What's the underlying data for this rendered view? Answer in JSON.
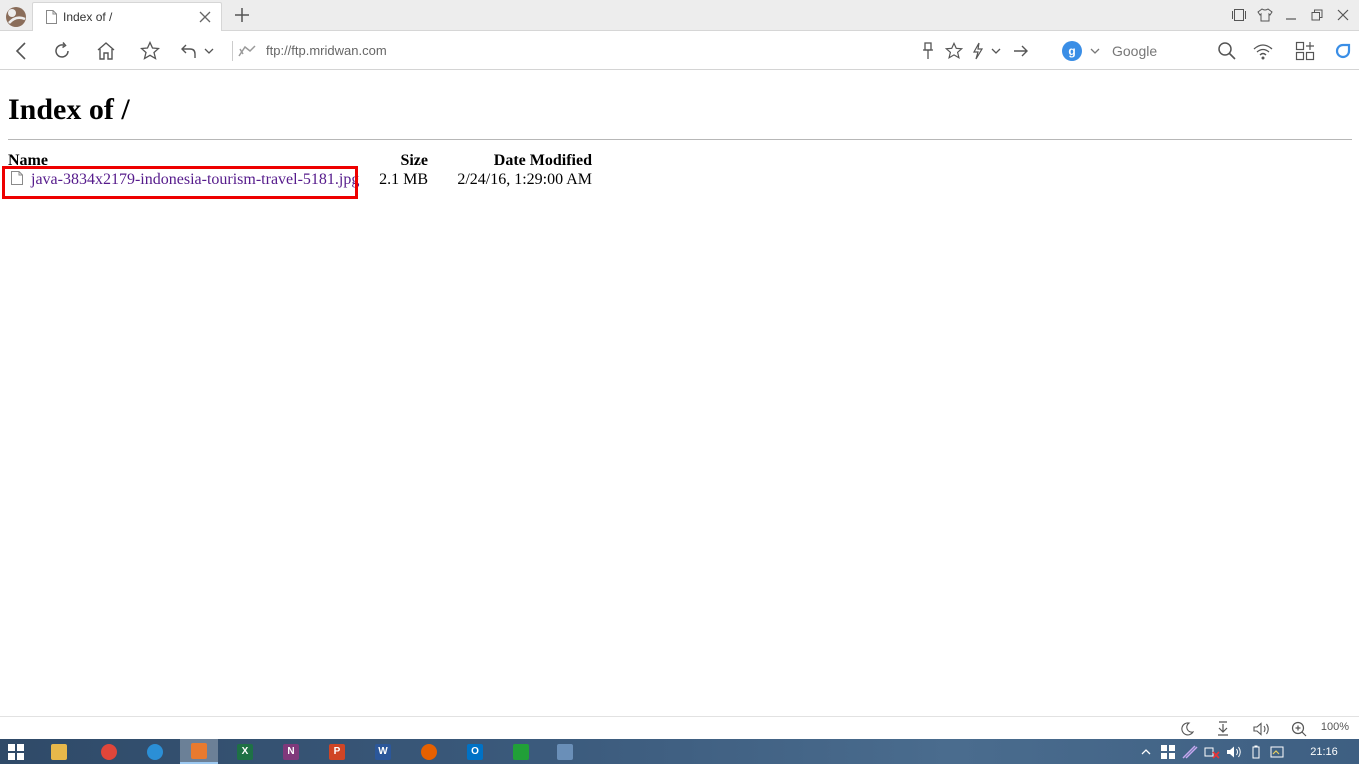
{
  "browser": {
    "tab": {
      "title": "Index of /"
    },
    "address_bar": {
      "url": "ftp://ftp.mridwan.com"
    },
    "search": {
      "engine_badge": "g",
      "label": "Google"
    }
  },
  "page": {
    "heading": "Index of /",
    "columns": {
      "name": "Name",
      "size": "Size",
      "date": "Date Modified"
    },
    "files": [
      {
        "name": "java-3834x2179-indonesia-tourism-travel-5181.jpg",
        "size": "2.1 MB",
        "date": "2/24/16, 1:29:00 AM"
      }
    ]
  },
  "status": {
    "zoom": "100%"
  },
  "taskbar": {
    "apps": [
      {
        "icon": "file-explorer-icon",
        "color": "#e8b84a"
      },
      {
        "icon": "chrome-icon",
        "color": "#e0463a"
      },
      {
        "icon": "internet-explorer-icon",
        "color": "#2b8fd6"
      },
      {
        "icon": "uc-browser-icon",
        "color": "#e87a2e"
      },
      {
        "icon": "excel-icon",
        "color": "#1e7145",
        "glyph": "X"
      },
      {
        "icon": "onenote-icon",
        "color": "#80397b",
        "glyph": "N"
      },
      {
        "icon": "powerpoint-icon",
        "color": "#d04525",
        "glyph": "P"
      },
      {
        "icon": "word-icon",
        "color": "#2b579a",
        "glyph": "W"
      },
      {
        "icon": "firefox-icon",
        "color": "#e66000"
      },
      {
        "icon": "outlook-icon",
        "color": "#0072c6",
        "glyph": "O"
      },
      {
        "icon": "spreadsheet-app-icon",
        "color": "#21a038"
      },
      {
        "icon": "virtualbox-icon",
        "color": "#6a8fb8"
      }
    ],
    "clock": "21:16"
  },
  "colors": {
    "highlight": "#ee0000",
    "visited_link": "#551a8b",
    "accent": "#3a8ee6"
  }
}
